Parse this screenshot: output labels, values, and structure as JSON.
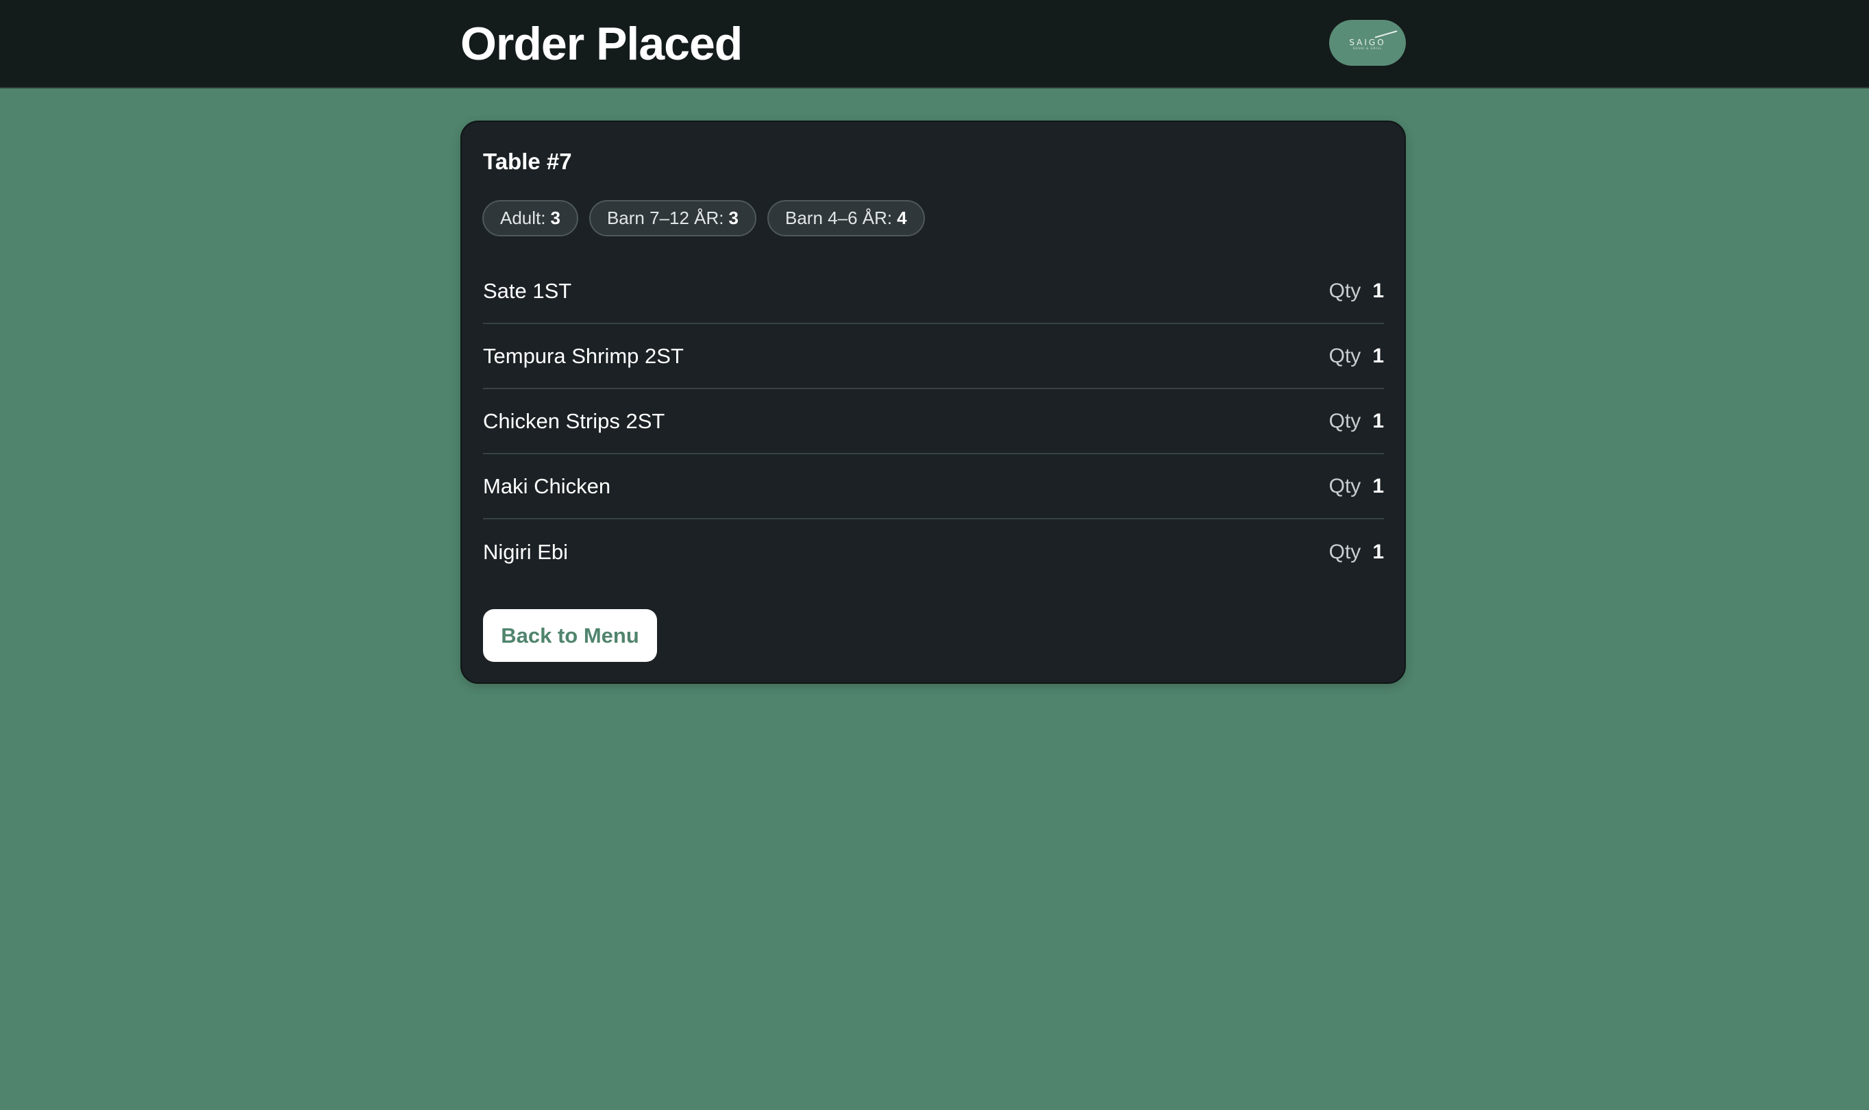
{
  "header": {
    "title": "Order Placed",
    "logo_text": "SAIGO",
    "logo_subtext": "SUSHI & GRILL",
    "logo_icon": "chopstick-stroke"
  },
  "order": {
    "table_title": "Table #7",
    "guests": [
      {
        "label": "Adult:",
        "count": "3"
      },
      {
        "label": "Barn 7–12 ÅR:",
        "count": "3"
      },
      {
        "label": "Barn 4–6 ÅR:",
        "count": "4"
      }
    ],
    "qty_label": "Qty",
    "items": [
      {
        "name": "Sate 1ST",
        "qty": "1"
      },
      {
        "name": "Tempura Shrimp 2ST",
        "qty": "1"
      },
      {
        "name": "Chicken Strips 2ST",
        "qty": "1"
      },
      {
        "name": "Maki Chicken",
        "qty": "1"
      },
      {
        "name": "Nigiri Ebi",
        "qty": "1"
      }
    ],
    "back_button_label": "Back to Menu"
  },
  "colors": {
    "page_background": "#50846d",
    "topbar_background": "#141b1b",
    "card_background": "#1b2124",
    "accent": "#50846d",
    "logo_pill": "#5a8d77"
  }
}
